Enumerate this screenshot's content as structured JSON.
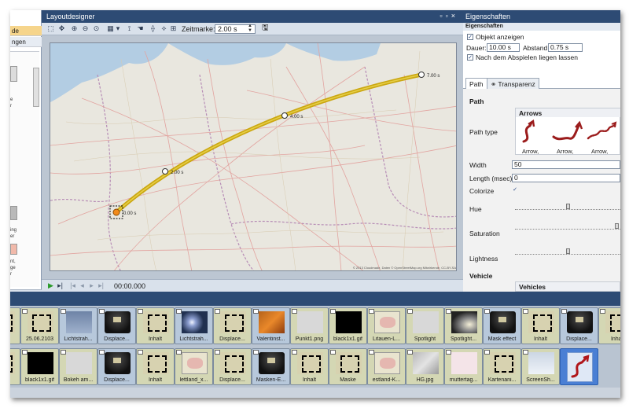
{
  "left_panel": {
    "tab1_label": "de",
    "tab2_label": "ngen",
    "snippet1": "e",
    "snippet2": "r",
    "snippet3": "ing",
    "snippet4": "er",
    "snippet5": "nt,",
    "snippet6": "ge",
    "snippet7": "r"
  },
  "layout_designer": {
    "title": "Layoutdesigner",
    "zeitmarke_label": "Zeitmarke:",
    "zeitmarke_value": "2.00 s",
    "timecode": "00:00.000",
    "attribution": "© 2013 Cloudmade, Daten © OpenStreetMap.org Mitwirkende, CC-BY-SA",
    "waypoints": [
      {
        "label": "0.00 s"
      },
      {
        "label": "2.00 s"
      },
      {
        "label": "4.00 s"
      },
      {
        "label": "7.00 s"
      }
    ]
  },
  "properties": {
    "title": "Eigenschaften",
    "section": "Eigenschaften",
    "show_object_label": "Objekt anzeigen",
    "show_object_checked": true,
    "duration_label": "Dauer:",
    "duration_value": "10.00 s",
    "distance_label": "Abstand:",
    "distance_value": "0.75 s",
    "after_play_label": "Nach dem Abspielen liegen lassen",
    "after_play_checked": true,
    "tabs": [
      {
        "label": "Path"
      },
      {
        "label": "Transparenz"
      }
    ],
    "path_heading": "Path",
    "arrows_heading": "Arrows",
    "path_type_label": "Path type",
    "arrow_items": [
      "Arrow,",
      "Arrow,",
      "Arrow,"
    ],
    "width_label": "Width",
    "width_value": "50",
    "length_label": "Length (msec)",
    "length_value": "0",
    "colorize_label": "Colorize",
    "colorize_checked": true,
    "hue_label": "Hue",
    "hue_value": 0.5,
    "saturation_label": "Saturation",
    "saturation_value": 0.96,
    "lightness_label": "Lightness",
    "lightness_value": 0.5,
    "vehicle_heading": "Vehicle",
    "vehicles_heading": "Vehicles"
  },
  "timeline": {
    "row1": [
      {
        "label": "",
        "pic": "mask"
      },
      {
        "label": "25.06.2103",
        "pic": "mask"
      },
      {
        "label": "Lichtstrah...",
        "pic": "sky"
      },
      {
        "label": "Displace...",
        "pic": "cube"
      },
      {
        "label": "Inhalt",
        "pic": "mask"
      },
      {
        "label": "Lichtstrah...",
        "pic": "light"
      },
      {
        "label": "Displace...",
        "pic": "mask"
      },
      {
        "label": "Valentinst...",
        "pic": "fire"
      },
      {
        "label": "Punkt1.png",
        "pic": "push"
      },
      {
        "label": "black1x1.gif",
        "pic": "black"
      },
      {
        "label": "Litauen-L...",
        "pic": "map"
      },
      {
        "label": "Spotlight",
        "pic": "push"
      },
      {
        "label": "Spotlight...",
        "pic": "spotlight"
      },
      {
        "label": "Mask effect",
        "pic": "cube"
      },
      {
        "label": "Inhalt",
        "pic": "mask"
      },
      {
        "label": "Displace...",
        "pic": "cube"
      },
      {
        "label": "Inhalt",
        "pic": "mask"
      }
    ],
    "row2": [
      {
        "label": "",
        "pic": "mask"
      },
      {
        "label": "black1x1.gif",
        "pic": "black"
      },
      {
        "label": "Bokeh am...",
        "pic": "push"
      },
      {
        "label": "Displace...",
        "pic": "cube"
      },
      {
        "label": "Inhalt",
        "pic": "mask"
      },
      {
        "label": "lettland_x...",
        "pic": "map"
      },
      {
        "label": "Displace...",
        "pic": "mask"
      },
      {
        "label": "Masken-E...",
        "pic": "cube"
      },
      {
        "label": "Inhalt",
        "pic": "mask"
      },
      {
        "label": "Maske",
        "pic": "mask"
      },
      {
        "label": "estland-K...",
        "pic": "map"
      },
      {
        "label": "HG.jpg",
        "pic": "stone"
      },
      {
        "label": "muttertag...",
        "pic": "pink"
      },
      {
        "label": "Kartenani...",
        "pic": "mask"
      },
      {
        "label": "ScreenSh...",
        "pic": "screen"
      },
      {
        "label": "",
        "pic": "selected"
      }
    ]
  },
  "colors": {
    "path": "#c8a200",
    "panel_title": "#2d4b74",
    "selection": "#4a7fd4"
  }
}
